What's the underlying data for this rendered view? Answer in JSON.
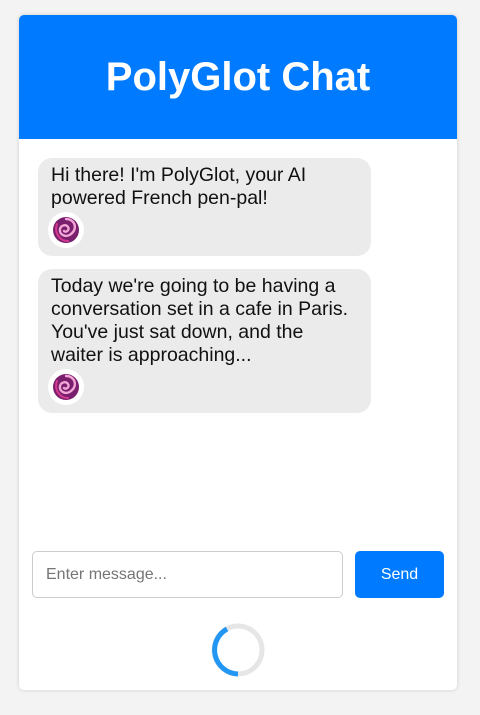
{
  "header": {
    "title": "PolyGlot Chat"
  },
  "messages": [
    {
      "text": "Hi there! I'm PolyGlot, your AI powered French pen-pal!",
      "avatar_icon": "polyglot-swirl-avatar"
    },
    {
      "text": "Today we're going to be having a conversation set in a cafe in Paris. You've just sat down, and the waiter is approaching...",
      "avatar_icon": "polyglot-swirl-avatar"
    }
  ],
  "composer": {
    "input_value": "",
    "placeholder": "Enter message...",
    "send_label": "Send"
  },
  "loading_indicator": "spinner-icon",
  "colors": {
    "accent": "#007bff",
    "bubble_bg": "#ebebeb",
    "page_bg": "#f3f3f3",
    "avatar_purple": "#7a1e6e",
    "avatar_pink": "#d63a8f"
  }
}
